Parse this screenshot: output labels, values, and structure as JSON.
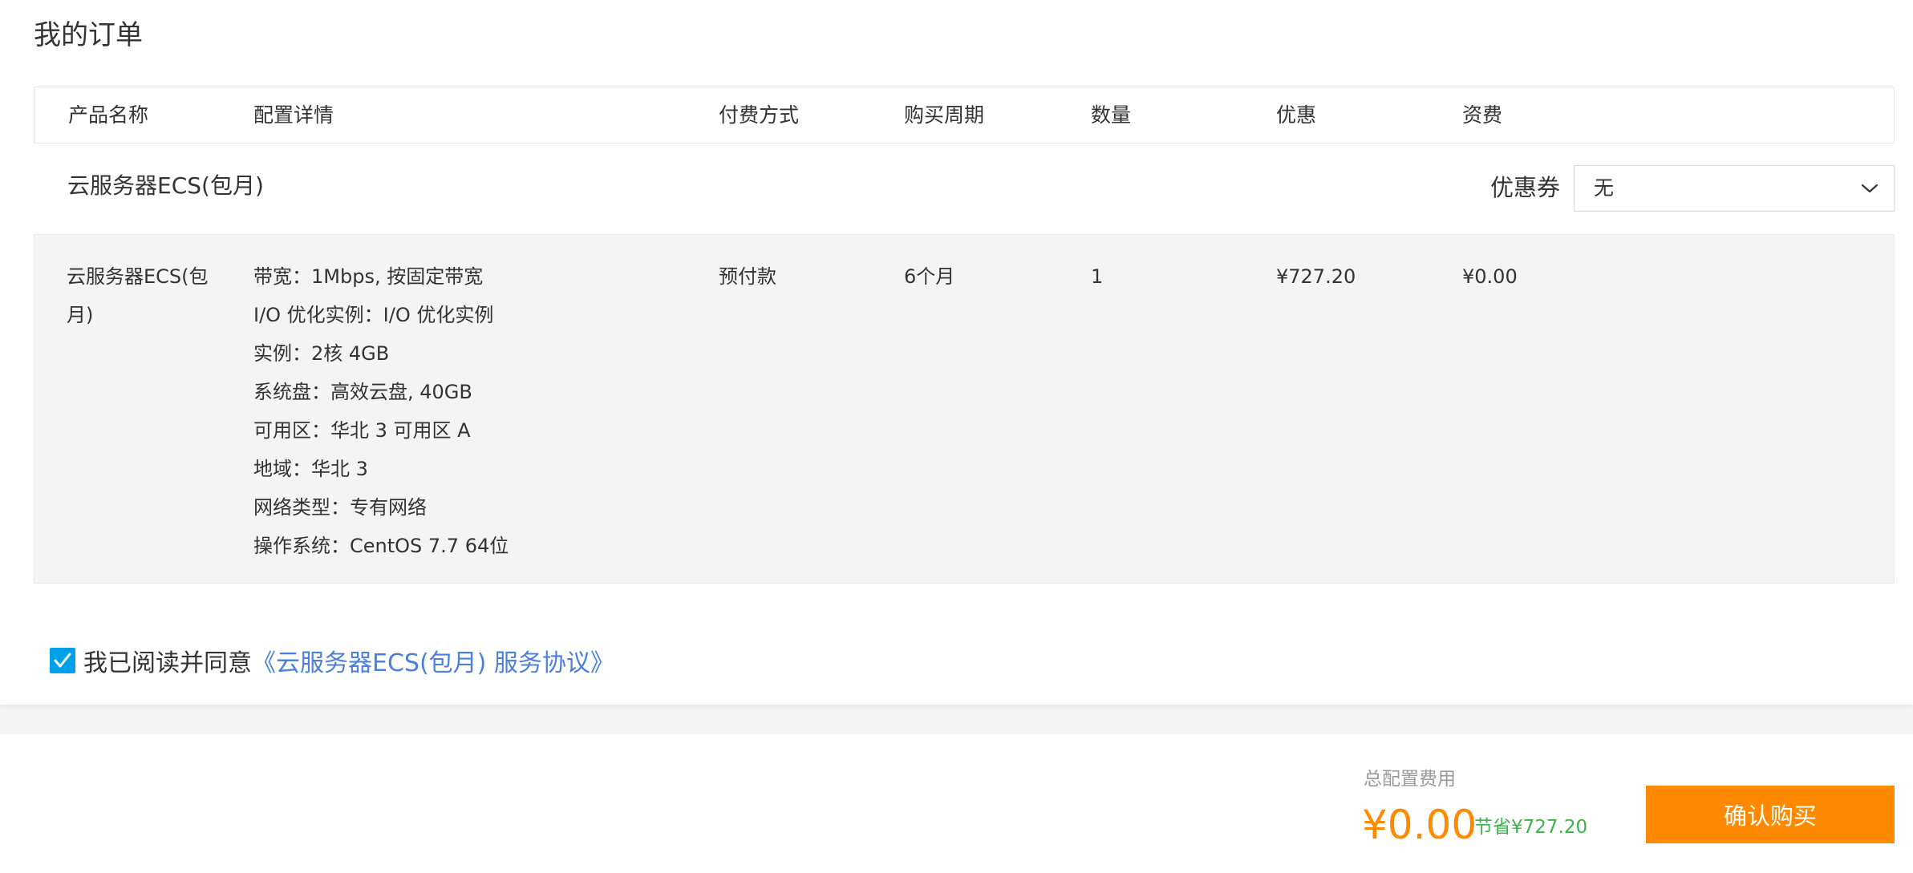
{
  "page_title": "我的订单",
  "table": {
    "headers": [
      "产品名称",
      "配置详情",
      "付费方式",
      "购买周期",
      "数量",
      "优惠",
      "资费"
    ]
  },
  "product_group": {
    "name": "云服务器ECS(包月)",
    "coupon_label": "优惠券",
    "coupon_value": "无"
  },
  "row": {
    "product_name": "云服务器ECS(包月)",
    "config": [
      "带宽：1Mbps, 按固定带宽",
      "I/O 优化实例：I/O 优化实例",
      "实例：2核 4GB",
      "系统盘：高效云盘, 40GB",
      "可用区：华北 3 可用区 A",
      "地域：华北 3",
      "网络类型：专有网络",
      "操作系统：CentOS 7.7 64位"
    ],
    "payment": "预付款",
    "period": "6个月",
    "quantity": "1",
    "discount": "¥727.20",
    "fee": "¥0.00"
  },
  "agreement": {
    "checked": true,
    "text": "我已阅读并同意",
    "link_text": "《云服务器ECS(包月) 服务协议》"
  },
  "footer": {
    "total_label": "总配置费用",
    "total_price": "¥0.00",
    "savings": "节省¥727.20",
    "confirm_label": "确认购买"
  },
  "colors": {
    "accent_orange": "#ff8a00",
    "savings_green": "#3bb449",
    "link_blue": "#4a7fe0",
    "checkbox_blue": "#00a0e9"
  }
}
